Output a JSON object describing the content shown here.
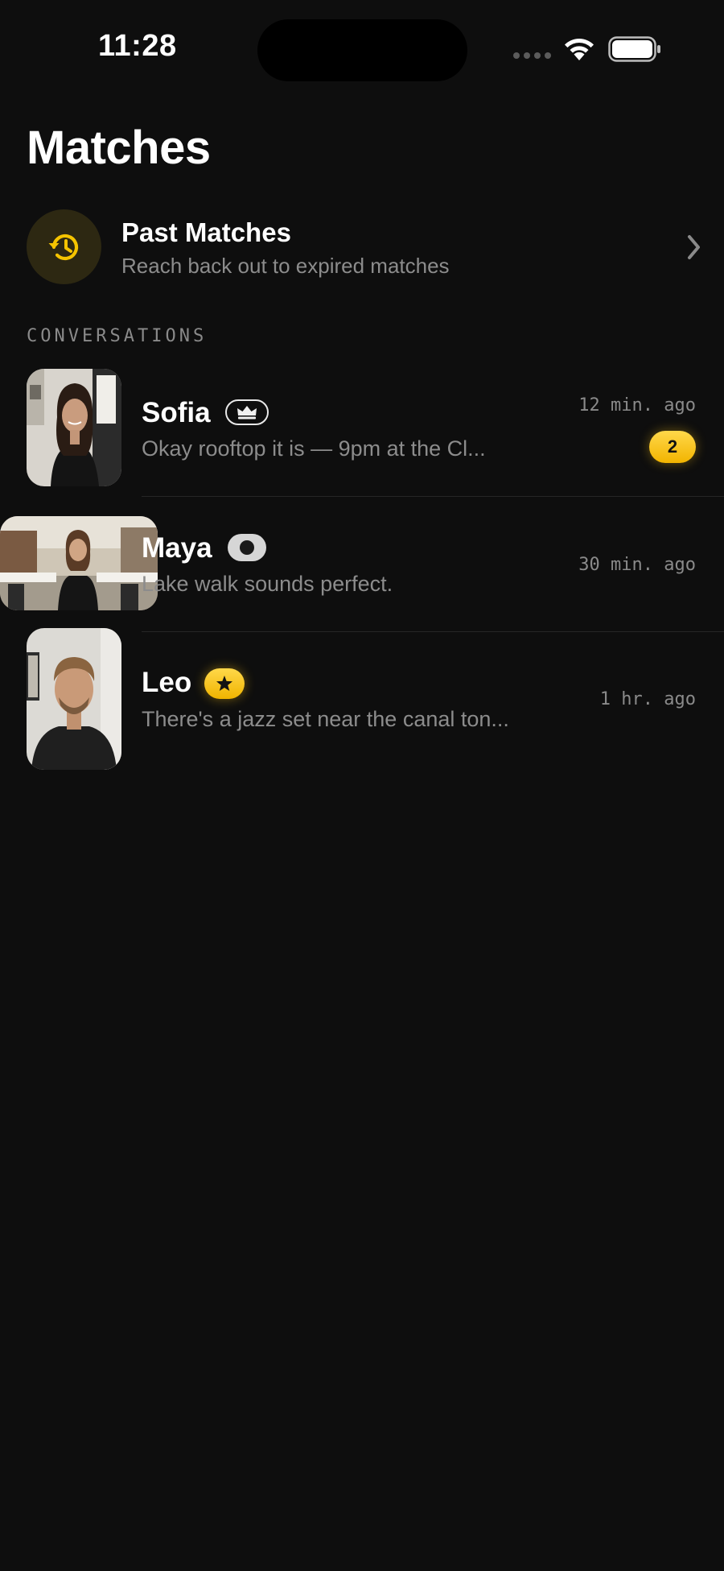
{
  "status_bar": {
    "time": "11:28"
  },
  "header": {
    "title": "Matches"
  },
  "past_matches": {
    "title": "Past Matches",
    "subtitle": "Reach back out to expired matches",
    "icon": "history-icon"
  },
  "section": {
    "label": "CONVERSATIONS"
  },
  "conversations": [
    {
      "name": "Sofia",
      "badge": "crown-icon",
      "message": "Okay rooftop it is — 9pm at the Cl...",
      "time": "12 min. ago",
      "unread": "2"
    },
    {
      "name": "Maya",
      "badge": "eye-icon",
      "message": "Lake walk sounds perfect.",
      "time": "30 min. ago"
    },
    {
      "name": "Leo",
      "badge": "star-icon",
      "message": "There's a jazz set near the canal ton...",
      "time": "1 hr. ago"
    }
  ],
  "colors": {
    "background": "#0e0e0e",
    "accent_gold": "#f5c400",
    "muted_text": "#8c8c8c"
  }
}
